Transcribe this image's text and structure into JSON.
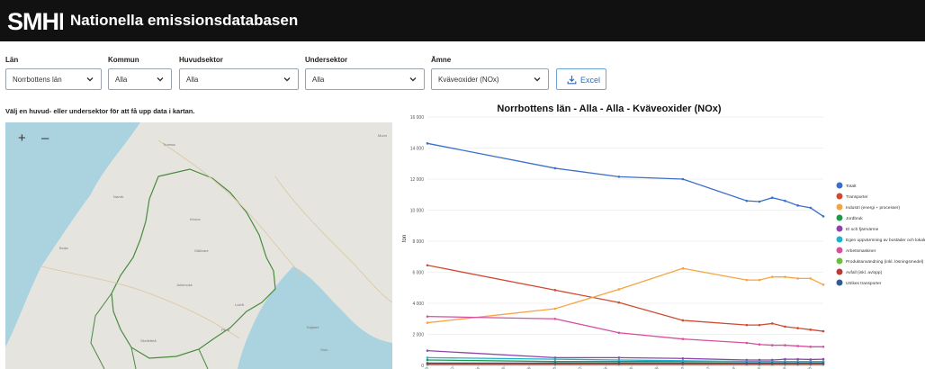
{
  "header": {
    "logo_text": "SMHI",
    "title": "Nationella emissionsdatabasen"
  },
  "filters": [
    {
      "label": "Län",
      "value": "Norrbottens län"
    },
    {
      "label": "Kommun",
      "value": "Alla"
    },
    {
      "label": "Huvudsektor",
      "value": "Alla"
    },
    {
      "label": "Undersektor",
      "value": "Alla"
    },
    {
      "label": "Ämne",
      "value": "Kväveoxider (NOx)"
    }
  ],
  "excel_button": {
    "label": "Excel",
    "icon": "download-icon"
  },
  "hint": "Välj en huvud- eller undersektor för att få upp data i kartan.",
  "map": {
    "zoom_in": "+",
    "zoom_out": "–",
    "labels": [
      "Mumi",
      "Tromsø",
      "Narvik",
      "Kiruna",
      "Gällivare",
      "Bodø",
      "Jokkmokk",
      "Luleå",
      "Piteå",
      "Skellefteå",
      "Oulu",
      "Kajaani"
    ]
  },
  "chart_data": {
    "type": "line",
    "title": "Norrbottens län - Alla - Alla - Kväveoxider (NOx)",
    "ylabel": "ton",
    "ylim": [
      0,
      16000
    ],
    "yticks": [
      "0",
      "2 000",
      "4 000",
      "6 000",
      "8 000",
      "10 000",
      "12 000",
      "14 000",
      "16 000"
    ],
    "xlim": [
      1990,
      2021
    ],
    "xticks": [
      "1990",
      "1992",
      "1994",
      "1996",
      "1998",
      "2000",
      "2002",
      "2004",
      "2006",
      "2008",
      "2010",
      "2012",
      "2014",
      "2016",
      "2018",
      "2020"
    ],
    "x": [
      1990,
      2000,
      2005,
      2010,
      2015,
      2016,
      2017,
      2018,
      2019,
      2020,
      2021
    ],
    "series": [
      {
        "name": "Totalt",
        "color": "#3b6fc9",
        "values": [
          14300,
          12700,
          12150,
          12000,
          10600,
          10550,
          10800,
          10600,
          10300,
          10150,
          9600
        ]
      },
      {
        "name": "Transporter",
        "color": "#d04a2f",
        "values": [
          6450,
          4850,
          4050,
          2900,
          2600,
          2600,
          2700,
          2500,
          2400,
          2300,
          2200
        ]
      },
      {
        "name": "Industri (energi + processer)",
        "color": "#f5a440",
        "values": [
          2750,
          3650,
          4900,
          6250,
          5500,
          5500,
          5700,
          5700,
          5600,
          5600,
          5200
        ]
      },
      {
        "name": "Jordbruk",
        "color": "#1f9a4a",
        "values": [
          350,
          250,
          250,
          250,
          250,
          250,
          250,
          250,
          250,
          250,
          250
        ]
      },
      {
        "name": "El och fjärrvärme",
        "color": "#8e44ad",
        "values": [
          950,
          500,
          500,
          450,
          350,
          350,
          350,
          400,
          400,
          380,
          400
        ]
      },
      {
        "name": "Egen uppvärmning av bostäder och lokaler",
        "color": "#1ab3c9",
        "values": [
          500,
          400,
          350,
          300,
          250,
          250,
          250,
          250,
          250,
          250,
          250
        ]
      },
      {
        "name": "Arbetsmaskiner",
        "color": "#d84fa0",
        "values": [
          3150,
          3000,
          2100,
          1700,
          1450,
          1350,
          1300,
          1300,
          1250,
          1200,
          1200
        ]
      },
      {
        "name": "Produktanvändning (inkl. lösningsmedel)",
        "color": "#6cbf3c",
        "values": [
          50,
          50,
          50,
          50,
          50,
          50,
          50,
          50,
          50,
          50,
          50
        ]
      },
      {
        "name": "Avfall (inkl. avlopp)",
        "color": "#b83a3a",
        "values": [
          100,
          100,
          100,
          100,
          100,
          100,
          100,
          100,
          100,
          100,
          100
        ]
      },
      {
        "name": "Utrikes transporter",
        "color": "#2e5c94",
        "values": [
          150,
          150,
          150,
          150,
          150,
          150,
          150,
          150,
          150,
          150,
          150
        ]
      }
    ],
    "legend_position": "right"
  }
}
